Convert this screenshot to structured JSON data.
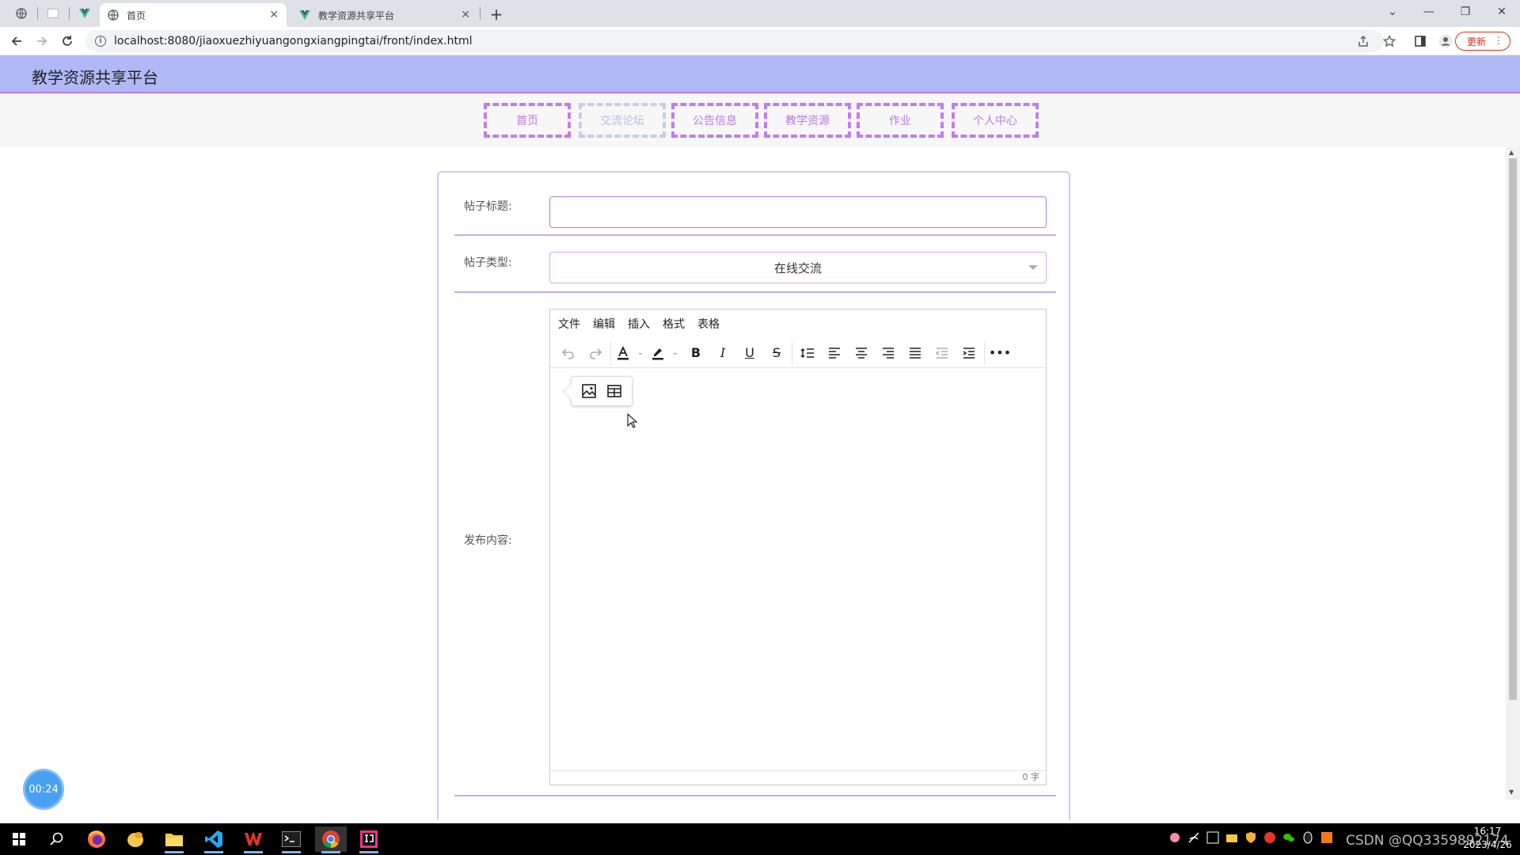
{
  "browser": {
    "tabs": [
      {
        "title": "首页",
        "active": true
      },
      {
        "title": "教学资源共享平台",
        "active": false
      }
    ],
    "url": "localhost:8080/jiaoxuezhiyuangongxiangpingtai/front/index.html",
    "update_label": "更新"
  },
  "site": {
    "title": "教学资源共享平台",
    "nav": [
      {
        "label": "首页"
      },
      {
        "label": "交流论坛"
      },
      {
        "label": "公告信息"
      },
      {
        "label": "教学资源"
      },
      {
        "label": "作业"
      },
      {
        "label": "个人中心"
      }
    ]
  },
  "form": {
    "title_label": "帖子标题:",
    "title_value": "",
    "type_label": "帖子类型:",
    "type_value": "在线交流",
    "content_label": "发布内容:"
  },
  "editor": {
    "menus": [
      "文件",
      "编辑",
      "插入",
      "格式",
      "表格"
    ],
    "word_count": "0 字"
  },
  "overlay": {
    "timer": "00:24"
  },
  "taskbar": {
    "time": "16:17",
    "date": "2023/4/26"
  },
  "watermark": "CSDN @QQ3359892174",
  "colors": {
    "header_bg": "#b0b8f5",
    "accent": "#c27bf0",
    "nav_text": "#b97ae8"
  }
}
